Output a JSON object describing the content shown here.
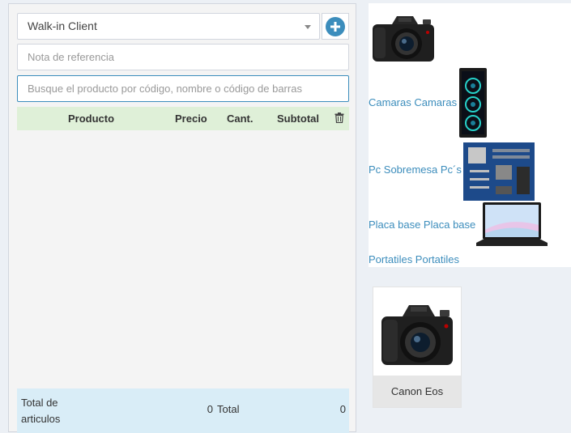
{
  "pos": {
    "customer_select": {
      "value": "Walk-in Client"
    },
    "reference_note": {
      "placeholder": "Nota de referencia"
    },
    "product_search": {
      "placeholder": "Busque el producto por código, nombre o código de barras"
    },
    "table": {
      "columns": [
        "Producto",
        "Precio",
        "Cant.",
        "Subtotal"
      ]
    },
    "totals": {
      "items_label": "Total de articulos",
      "items_value": "0",
      "total_label": "Total",
      "total_value": "0"
    }
  },
  "categories": [
    {
      "label": "Camaras Camaras",
      "icon": "camera-icon"
    },
    {
      "label": "Pc Sobremesa Pc´s",
      "icon": "desktop-pc-icon"
    },
    {
      "label": "Placa base Placa base",
      "icon": "motherboard-icon"
    },
    {
      "label": "Portatiles Portatiles",
      "icon": "laptop-icon"
    }
  ],
  "products": [
    {
      "name": "Canon Eos",
      "icon": "camera-icon"
    }
  ],
  "colors": {
    "accent": "#3c8dbc",
    "table_header_bg": "#dff0d8",
    "totals_bg": "#d9edf7",
    "page_bg": "#ecf0f5"
  }
}
